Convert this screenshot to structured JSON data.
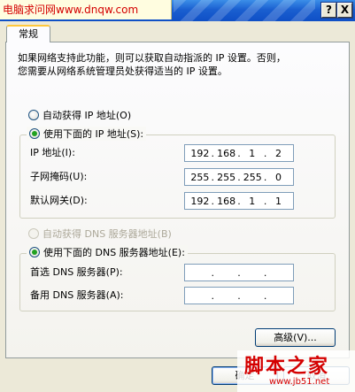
{
  "watermark": {
    "top": "电脑求问网www.dnqw.com",
    "bottom_cn": "脚本之家",
    "bottom_url": "www.jb51.net"
  },
  "titlebar": {
    "help": "?",
    "close": "X"
  },
  "tab": {
    "label": "常规"
  },
  "intro": "如果网络支持此功能，则可以获取自动指派的 IP 设置。否则，\n您需要从网络系统管理员处获得适当的 IP 设置。",
  "ip": {
    "auto_label": "自动获得 IP 地址(O)",
    "manual_label": "使用下面的 IP 地址(S):",
    "fields": [
      {
        "label": "IP 地址(I):",
        "value": [
          "192",
          "168",
          "1",
          "2"
        ]
      },
      {
        "label": "子网掩码(U):",
        "value": [
          "255",
          "255",
          "255",
          "0"
        ]
      },
      {
        "label": "默认网关(D):",
        "value": [
          "192",
          "168",
          "1",
          "1"
        ]
      }
    ]
  },
  "dns": {
    "auto_label": "自动获得 DNS 服务器地址(B)",
    "manual_label": "使用下面的 DNS 服务器地址(E):",
    "fields": [
      {
        "label": "首选 DNS 服务器(P):",
        "value": [
          "",
          "",
          "",
          ""
        ]
      },
      {
        "label": "备用 DNS 服务器(A):",
        "value": [
          "",
          "",
          "",
          ""
        ]
      }
    ]
  },
  "buttons": {
    "advanced": "高级(V)...",
    "ok": "确定",
    "cancel": "取消"
  },
  "dot": "."
}
